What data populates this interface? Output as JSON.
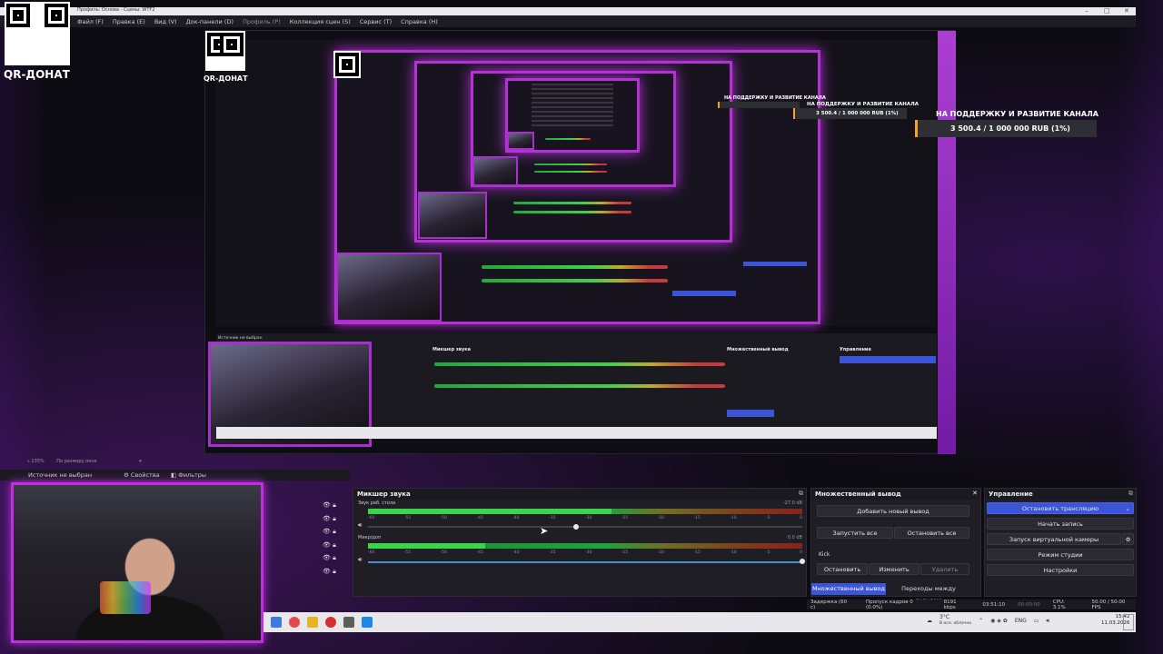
{
  "window": {
    "title": "Профиль: Основа - Сцены: WTF2",
    "menu": [
      "Файл (F)",
      "Правка (E)",
      "Вид (V)",
      "Док-панели (D)",
      "Профиль (P)",
      "Коллекция сцен (S)",
      "Сервис (T)",
      "Справка (H)"
    ]
  },
  "qr": {
    "label": "QR-ДОНАТ"
  },
  "donation": {
    "title": "НА ПОДДЕРЖКУ И РАЗВИТИЕ КАНАЛА",
    "value": "3 500.4 / 1 000 000 RUB (1%)",
    "progress_percent": 1,
    "accent": "#f6a21a"
  },
  "preview": {
    "zoom": "135%",
    "fit_label": "По размеру окна"
  },
  "source_bar": {
    "label": "Источник не выбран",
    "properties": "Свойства",
    "filters": "Фильтры"
  },
  "mixer": {
    "title": "Микшер звука",
    "channels": [
      {
        "name": "Звук раб. стола",
        "db": "-27.0 dB",
        "level": 0.56,
        "volume": 0.48
      },
      {
        "name": "Микр/доп",
        "db": "0.0 dB",
        "level": 0.27,
        "volume": 1.0
      }
    ],
    "scale": [
      "-60",
      "-55",
      "-50",
      "-45",
      "-40",
      "-35",
      "-30",
      "-25",
      "-20",
      "-15",
      "-10",
      "-5",
      "0"
    ]
  },
  "multi_output": {
    "title": "Множественный вывод",
    "add_button": "Добавить новый вывод",
    "start_all": "Запустить все",
    "stop_all": "Остановить все",
    "target_name": "Kick",
    "stop": "Остановить",
    "edit": "Изменить",
    "delete": "Удалить",
    "tab_active": "Множественный вывод",
    "tab_other": "Переходы между сценами"
  },
  "controls": {
    "title": "Управление",
    "stop_stream": "Остановить трансляцию",
    "start_record": "Начать запись",
    "virtual_cam": "Запуск виртуальной камеры",
    "studio_mode": "Режим студии",
    "settings": "Настройки"
  },
  "status": {
    "delay": "Задержка (60 с)",
    "dropped": "Пропуск кадров 0 (0.0%)",
    "bitrate": "8191 kbps",
    "time": "03:51:10",
    "rec_time": "00:00:00",
    "cpu": "CPU: 3.1%",
    "fps": "50.00 / 50.00 FPS"
  },
  "taskbar": {
    "tray_weather": "3°C",
    "tray_weather_sub": "В осн. облачно",
    "lang": "ENG",
    "clock_time": "15:42",
    "clock_date": "11.03.2026",
    "icon_colors": [
      "#3c7bd9",
      "#e64949",
      "#e6b422",
      "#d4312c",
      "#5d5d5d",
      "#1e88e5"
    ]
  },
  "colors": {
    "accent_purple": "#b531d6",
    "primary_blue": "#3b54d8"
  }
}
